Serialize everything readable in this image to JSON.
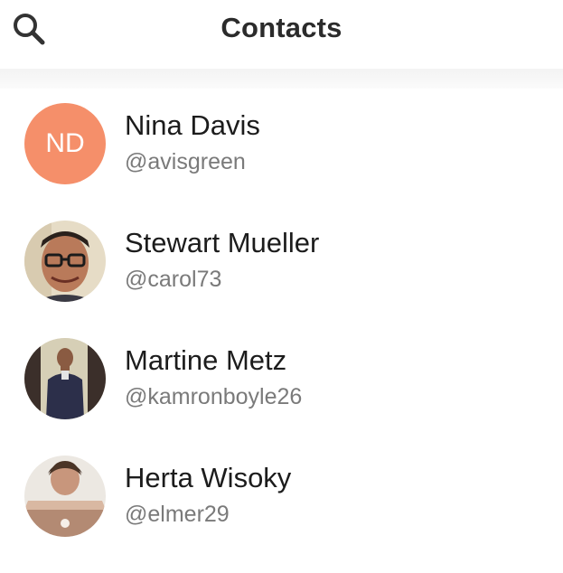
{
  "header": {
    "title": "Contacts",
    "search_icon": "search-icon"
  },
  "colors": {
    "accent_initials_bg": "#f58f6a",
    "title_text": "#2b2b2b",
    "handle_text": "#7a7a7a"
  },
  "contacts": [
    {
      "name": "Nina Davis",
      "handle": "@avisgreen",
      "initials": "ND",
      "avatar_type": "initials"
    },
    {
      "name": "Stewart Mueller",
      "handle": "@carol73",
      "avatar_type": "photo"
    },
    {
      "name": "Martine Metz",
      "handle": "@kamronboyle26",
      "avatar_type": "photo"
    },
    {
      "name": "Herta Wisoky",
      "handle": "@elmer29",
      "avatar_type": "photo"
    }
  ]
}
